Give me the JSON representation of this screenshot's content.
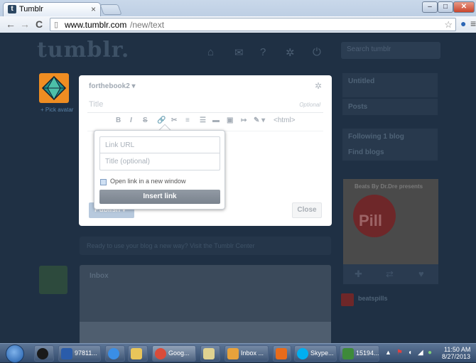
{
  "browser": {
    "tab_title": "Tumblr",
    "tab_close": "×",
    "url_host": "www.tumblr.com",
    "url_path": "/new/text",
    "window_buttons": [
      "‒",
      "□",
      "✕"
    ]
  },
  "tumblr": {
    "logo": "tumblr.",
    "search_placeholder": "Search tumblr",
    "pick_avatar": "+ Pick avatar",
    "right_col": {
      "blog_title": "Untitled",
      "posts": "Posts",
      "following": "Following 1 blog",
      "find": "Find blogs"
    },
    "promo_header": "Beats By Dr.Dre presents",
    "promo_text": "Pill",
    "notice": "Ready to use your blog a new way? Visit the Tumblr Center",
    "dash_post_title": "Inbox",
    "mini_name": "beatspills"
  },
  "editor": {
    "blog_name": "forthebook2 ▾",
    "title_placeholder": "Title",
    "title_optional": "Optional",
    "toolbar": [
      "B",
      "I",
      "S",
      "🔗",
      "✂",
      "≡",
      "☰",
      "▬",
      "▣",
      "↦",
      "✎ ▾",
      "<html>"
    ],
    "publish": "Publish ▾",
    "close": "Close"
  },
  "link_popup": {
    "url_placeholder": "Link URL",
    "title_placeholder": "Title (optional)",
    "new_window_label": "Open link in a new window",
    "insert_button": "Insert link"
  },
  "taskbar": {
    "items": [
      {
        "label": "97811...",
        "color": "#2a5caa"
      },
      {
        "label": "Goog...",
        "color": "#d94c3b"
      },
      {
        "label": "Inbox ...",
        "color": "#e8a23b"
      },
      {
        "label": "Skype...",
        "color": "#00aff0"
      },
      {
        "label": "15194...",
        "color": "#3e8a3a"
      }
    ],
    "time": "11:50 AM",
    "date": "8/27/2013"
  },
  "colors": {
    "avatar_orange": "#ef8d22",
    "insert_button": "#868e98",
    "page_bg": "#1f3044"
  }
}
